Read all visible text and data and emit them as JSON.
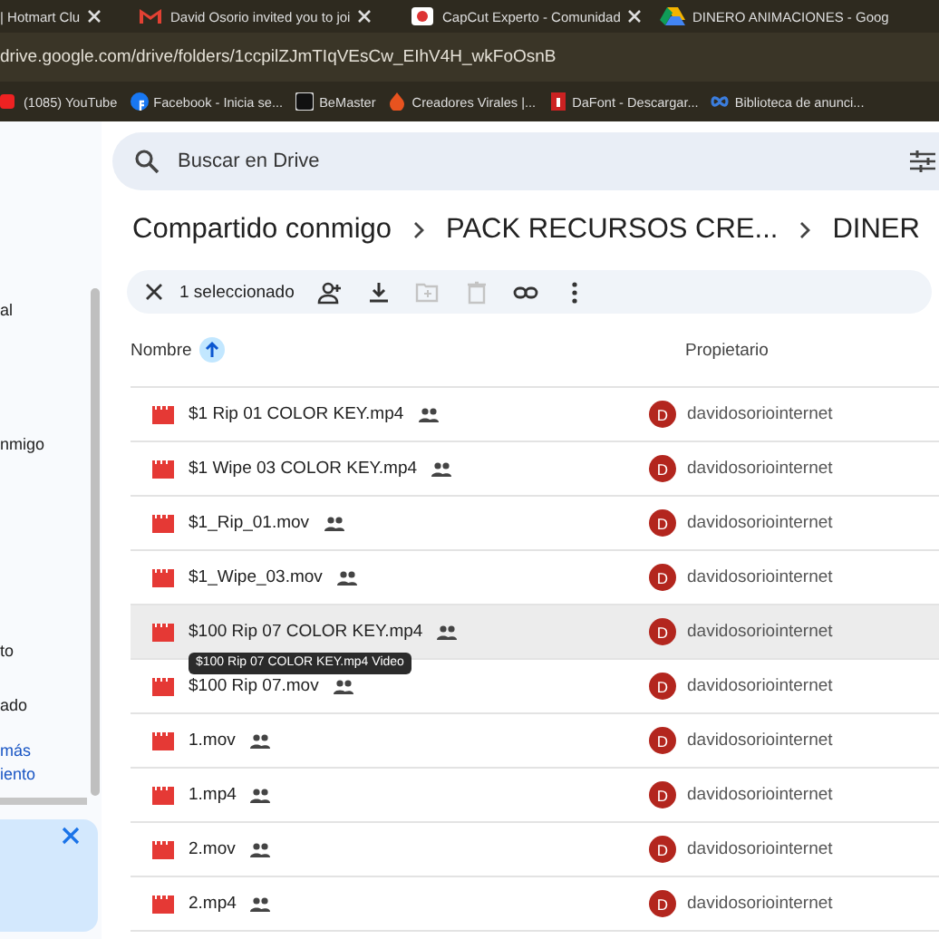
{
  "browser": {
    "tabs": [
      {
        "title": "| Hotmart Clu",
        "closable": true
      },
      {
        "title": "David Osorio invited you to joi",
        "closable": true
      },
      {
        "title": "CapCut Experto - Comunidad",
        "closable": true
      },
      {
        "title": "DINERO ANIMACIONES - Goog",
        "closable": false
      }
    ],
    "address": "drive.google.com/drive/folders/1ccpilZJmTIqVEsCw_EIhV4H_wkFoOsnB",
    "bookmarks": [
      "(1085) YouTube",
      "Facebook - Inicia se...",
      "BeMaster",
      "Creadores Virales |...",
      "DaFont - Descargar...",
      "Biblioteca de anunci..."
    ]
  },
  "sidebar": {
    "items": [
      {
        "label": "al",
        "kind": "item"
      },
      {
        "label": "nmigo",
        "kind": "item"
      },
      {
        "label": "to",
        "kind": "item"
      },
      {
        "label": "ado",
        "kind": "item"
      },
      {
        "label": "más",
        "kind": "link"
      },
      {
        "label": "iento",
        "kind": "link"
      }
    ]
  },
  "search": {
    "placeholder": "Buscar en Drive"
  },
  "breadcrumb": [
    "Compartido conmigo",
    "PACK RECURSOS CRE...",
    "DINER"
  ],
  "selection": {
    "count_label": "1 seleccionado",
    "tools": [
      {
        "kind": "share",
        "disabled": false
      },
      {
        "kind": "download",
        "disabled": false
      },
      {
        "kind": "move",
        "disabled": true
      },
      {
        "kind": "trash",
        "disabled": true
      },
      {
        "kind": "link",
        "disabled": false
      },
      {
        "kind": "more",
        "disabled": false
      }
    ]
  },
  "table": {
    "columns": [
      {
        "label": "Nombre",
        "sorted": true
      },
      {
        "label": "Propietario",
        "sorted": false
      }
    ],
    "rows": [
      {
        "name": "$1 Rip 01 COLOR KEY.mp4",
        "shared": true,
        "owner_initial": "D",
        "owner": "davidosoriointernet",
        "selected": false
      },
      {
        "name": "$1 Wipe 03 COLOR KEY.mp4",
        "shared": true,
        "owner_initial": "D",
        "owner": "davidosoriointernet",
        "selected": false
      },
      {
        "name": "$1_Rip_01.mov",
        "shared": true,
        "owner_initial": "D",
        "owner": "davidosoriointernet",
        "selected": false
      },
      {
        "name": "$1_Wipe_03.mov",
        "shared": true,
        "owner_initial": "D",
        "owner": "davidosoriointernet",
        "selected": false
      },
      {
        "name": "$100 Rip 07 COLOR KEY.mp4",
        "shared": true,
        "owner_initial": "D",
        "owner": "davidosoriointernet",
        "selected": true
      },
      {
        "name": "$100 Rip 07.mov",
        "shared": true,
        "owner_initial": "D",
        "owner": "davidosoriointernet",
        "selected": false
      },
      {
        "name": "1.mov",
        "shared": true,
        "owner_initial": "D",
        "owner": "davidosoriointernet",
        "selected": false
      },
      {
        "name": "1.mp4",
        "shared": true,
        "owner_initial": "D",
        "owner": "davidosoriointernet",
        "selected": false
      },
      {
        "name": "2.mov",
        "shared": true,
        "owner_initial": "D",
        "owner": "davidosoriointernet",
        "selected": false
      },
      {
        "name": "2.mp4",
        "shared": true,
        "owner_initial": "D",
        "owner": "davidosoriointernet",
        "selected": false
      }
    ]
  },
  "tooltip": "$100 Rip 07 COLOR KEY.mp4 Video"
}
